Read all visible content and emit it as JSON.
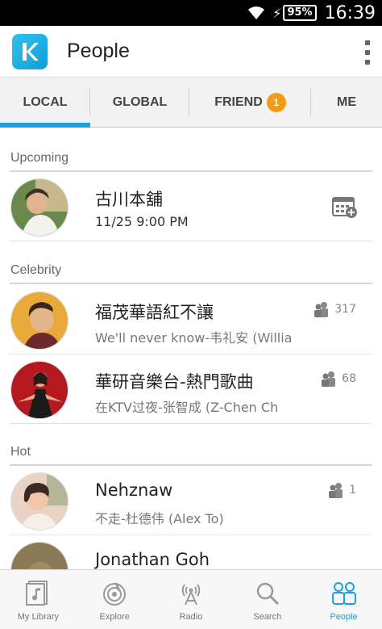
{
  "status_bar": {
    "battery": "95%",
    "time": "16:39"
  },
  "app_bar": {
    "title": "People"
  },
  "tabs": [
    {
      "label": "LOCAL",
      "active": true
    },
    {
      "label": "GLOBAL",
      "active": false
    },
    {
      "label": "FRIEND",
      "badge": "1",
      "active": false
    },
    {
      "label": "ME",
      "active": false
    }
  ],
  "sections": {
    "upcoming": {
      "header": "Upcoming",
      "items": [
        {
          "title": "古川本舖",
          "subtitle": "11/25 9:00 PM",
          "action_icon": "calendar-add-icon"
        }
      ]
    },
    "celebrity": {
      "header": "Celebrity",
      "items": [
        {
          "title": "福茂華語紅不讓",
          "subtitle": "We'll never know-韦礼安 (Willia",
          "count": "317"
        },
        {
          "title": "華研音樂台-熱門歌曲",
          "subtitle": "在KTV过夜-张智成 (Z-Chen Ch",
          "count": "68"
        }
      ]
    },
    "hot": {
      "header": "Hot",
      "items": [
        {
          "title": "Nehznaw",
          "subtitle": "不走-杜德伟 (Alex To)",
          "count": "1"
        },
        {
          "title": "Jonathan Goh"
        }
      ]
    }
  },
  "bottom_nav": [
    {
      "label": "My Library",
      "icon": "library-icon",
      "active": false
    },
    {
      "label": "Explore",
      "icon": "explore-icon",
      "active": false
    },
    {
      "label": "Radio",
      "icon": "radio-icon",
      "active": false
    },
    {
      "label": "Search",
      "icon": "search-icon",
      "active": false
    },
    {
      "label": "People",
      "icon": "people-icon",
      "active": true
    }
  ],
  "colors": {
    "accent": "#1ea1d8",
    "badge": "#f39c12",
    "status_bar": "#000000"
  }
}
